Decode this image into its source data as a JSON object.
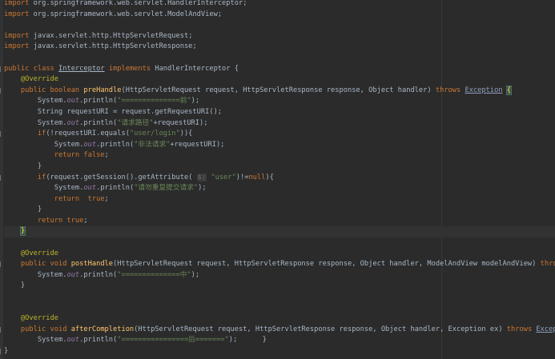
{
  "editor": {
    "language": "java",
    "colors": {
      "background": "#2b2b2b",
      "keyword": "#cc7832",
      "string": "#6a8759",
      "annotation": "#bbb529",
      "method": "#ffc66d",
      "field": "#9876aa",
      "number": "#6897bb",
      "text": "#a9b7c6"
    },
    "lines": [
      "import org.springframework.web.servlet.HandlerInterceptor;",
      "import org.springframework.web.servlet.ModelAndView;",
      "",
      "import javax.servlet.http.HttpServletRequest;",
      "import javax.servlet.http.HttpServletResponse;",
      "",
      "public class Interceptor implements HandlerInterceptor {",
      "    @Override",
      "    public boolean preHandle(HttpServletRequest request, HttpServletResponse response, Object handler) throws Exception {",
      "        System.out.println(\"==============前\");",
      "        String requestURI = request.getRequestURI();",
      "        System.out.println(\"请求路径\"+requestURI);",
      "        if(!requestURI.equals(\"user/login\")){",
      "            System.out.println(\"非法请求\"+requestURI);",
      "            return false;",
      "        }",
      "        if(request.getSession().getAttribute( s: \"user\")!=null){",
      "            System.out.println(\"请勿重复提交请求\");",
      "            return  true;",
      "        }",
      "        return true;",
      "    }",
      "",
      "    @Override",
      "    public void postHandle(HttpServletRequest request, HttpServletResponse response, Object handler, ModelAndView modelAndView) throws Exception {",
      "        System.out.println(\"==============中\");",
      "    }",
      "",
      "",
      "    @Override",
      "    public void afterCompletion(HttpServletRequest request, HttpServletResponse response, Object handler, Exception ex) throws Exception {",
      "        System.out.println(\"================后=======\");      }",
      "}"
    ]
  }
}
